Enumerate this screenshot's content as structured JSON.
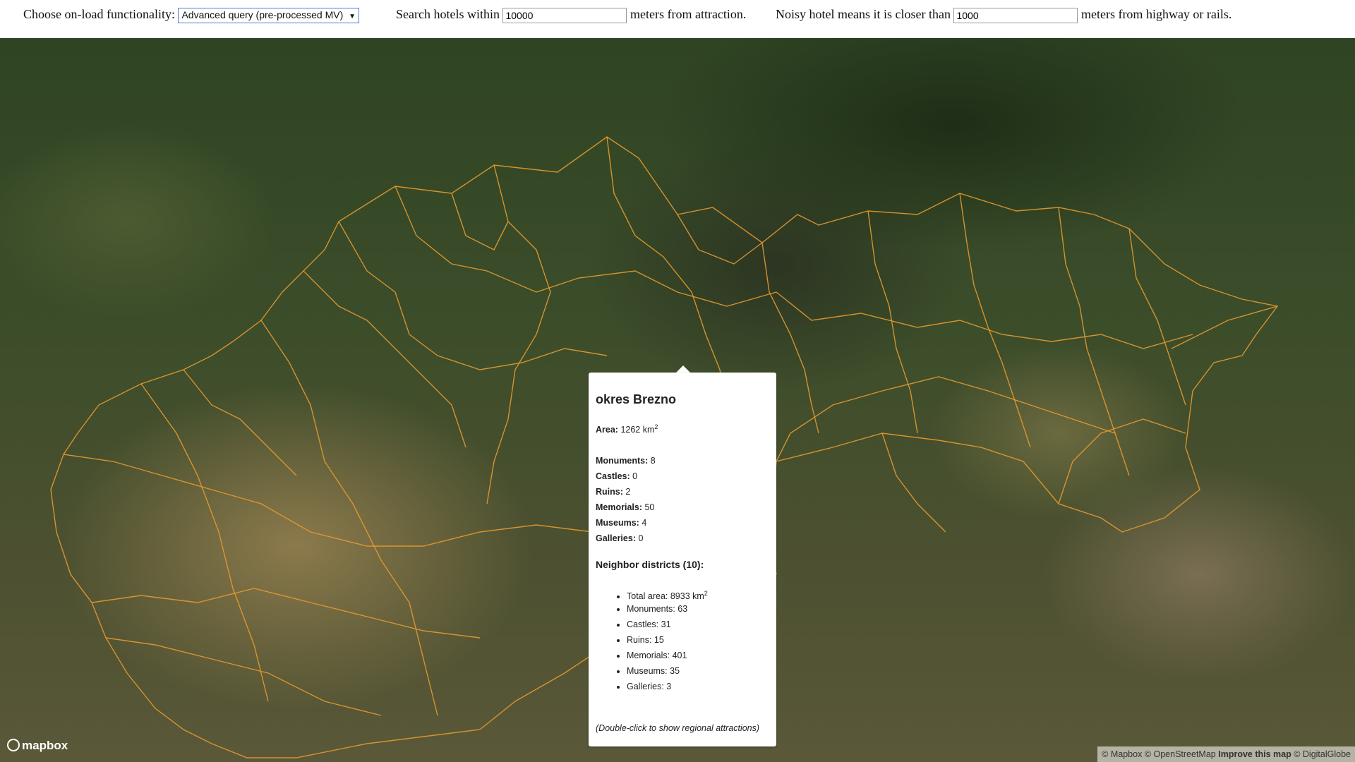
{
  "controls": {
    "mode_label": "Choose on-load functionality:",
    "mode_value": "Advanced query (pre-processed MV)",
    "search_prefix": "Search hotels within",
    "search_distance": "10000",
    "search_suffix": "meters from attraction.",
    "noisy_prefix": "Noisy hotel means it is closer than",
    "noisy_distance": "1000",
    "noisy_suffix": "meters from highway or rails."
  },
  "popup": {
    "title": "okres Brezno",
    "area_label": "Area:",
    "area_value": "1262 km",
    "area_unit_sup": "2",
    "stats": [
      {
        "label": "Monuments:",
        "value": "8"
      },
      {
        "label": "Castles:",
        "value": "0"
      },
      {
        "label": "Ruins:",
        "value": "2"
      },
      {
        "label": "Memorials:",
        "value": "50"
      },
      {
        "label": "Museums:",
        "value": "4"
      },
      {
        "label": "Galleries:",
        "value": "0"
      }
    ],
    "neighbors_title": "Neighbor districts (10):",
    "neighbors": {
      "total_area": "Total area: 8933 km",
      "total_area_sup": "2",
      "items": [
        "Monuments: 63",
        "Castles: 31",
        "Ruins: 15",
        "Memorials: 401",
        "Museums: 35",
        "Galleries: 3"
      ]
    },
    "hint": "(Double-click to show regional attractions)"
  },
  "map": {
    "logo": "mapbox",
    "attribution": {
      "mapbox": "© Mapbox",
      "osm": "© OpenStreetMap",
      "improve": "Improve this map",
      "digitalglobe": "© DigitalGlobe"
    },
    "border_color": "#e59a2e"
  }
}
